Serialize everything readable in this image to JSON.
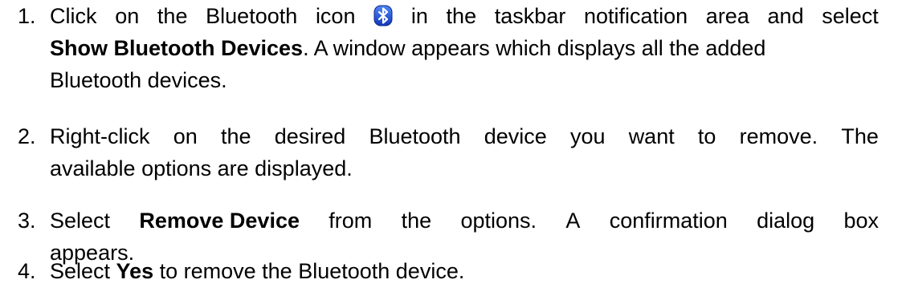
{
  "steps": [
    {
      "number": "1.",
      "line1": [
        "Click",
        "on",
        "the",
        "Bluetooth",
        "icon",
        "BT",
        "in",
        "the",
        "taskbar",
        "notification",
        "area",
        "and",
        "select"
      ],
      "line2_bold": "Show Bluetooth Devices",
      "line2_rest": ". A window appears which displays all the added",
      "line3": "Bluetooth devices.",
      "icon": "bluetooth-icon"
    },
    {
      "number": "2.",
      "line1": [
        "Right-click",
        "on",
        "the",
        "desired",
        "Bluetooth",
        "device",
        "you",
        "want",
        "to",
        "remove.",
        "The"
      ],
      "line2": "available options are displayed."
    },
    {
      "number": "3.",
      "line1_pre": "Select",
      "line1_bold": "Remove Device",
      "line1_words": [
        "from",
        "the",
        "options.",
        "A",
        "confirmation",
        "dialog",
        "box"
      ],
      "line2": "appears."
    },
    {
      "number": "4.",
      "pre": "Select ",
      "bold": "Yes",
      "post": " to remove the Bluetooth device."
    }
  ],
  "colors": {
    "text": "#000000",
    "bluetooth_blue": "#1b4fd6"
  }
}
